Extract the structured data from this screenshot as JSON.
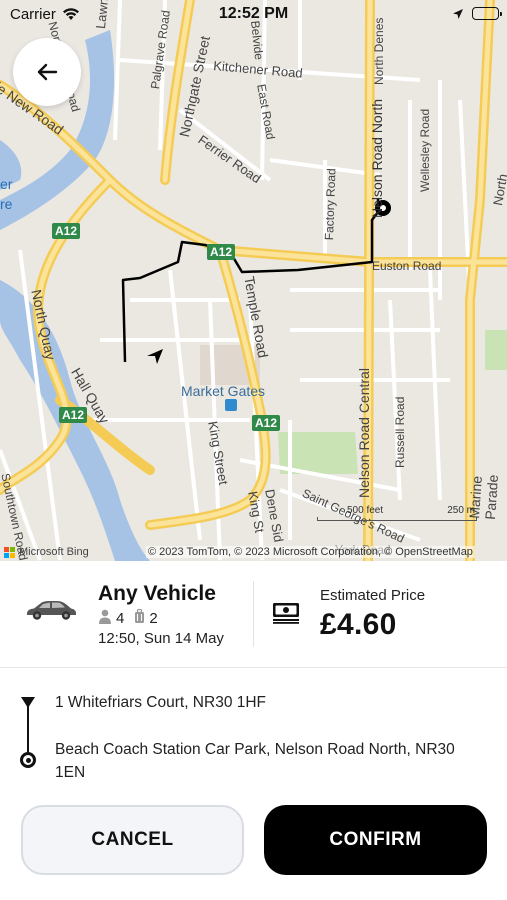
{
  "status_bar": {
    "carrier": "Carrier",
    "time": "12:52 PM"
  },
  "map": {
    "labels": {
      "lawn_avenue": "Lawn Ave",
      "north_river_road": "North River Road",
      "palgrave_road": "Palgrave Road",
      "northgate_street": "Northgate Street",
      "belvidere": "Belvide",
      "north_denes": "North Denes",
      "kitchener_road": "Kitchener Road",
      "east_road": "East Road",
      "ferrier_road": "Ferrier Road",
      "wellesley_road": "Wellesley Road",
      "north_drive": "North Drive",
      "nelson_road_north": "Nelson Road North",
      "factory_road": "Factory Road",
      "euston_road": "Euston Road",
      "new_road": "de New Road",
      "er": "er",
      "re": "re",
      "a12_1": "A12",
      "a12_2": "A12",
      "a12_3": "A12",
      "a12_4": "A12",
      "north_quay": "North Quay",
      "hall_quay": "Hall Quay",
      "temple_road": "Temple Road",
      "market_gates": "Market Gates",
      "king_street": "King Street",
      "king_st2": "King St",
      "dene_side": "Dene Sid",
      "nelson_road_central": "Nelson Road Central",
      "russell_road": "Russell Road",
      "marine_parade": "Marine Parade",
      "southtown": "Southtown Road",
      "saint_george": "Saint George's Road",
      "york_road": "York Road"
    },
    "scale_left": "500 feet",
    "scale_right": "250 m",
    "bing_label": "Microsoft Bing",
    "copyright": "© 2023 TomTom, © 2023 Microsoft Corporation, © OpenStreetMap"
  },
  "vehicle": {
    "name": "Any Vehicle",
    "passengers": "4",
    "luggage": "2",
    "time": "12:50, Sun 14 May",
    "icon": "car-icon"
  },
  "price": {
    "label": "Estimated Price",
    "value": "£4.60",
    "icon": "banknote-icon"
  },
  "route": {
    "pickup": "1 Whitefriars Court, NR30 1HF",
    "dropoff": "Beach Coach Station Car Park, Nelson Road North, NR30 1EN"
  },
  "buttons": {
    "cancel": "CANCEL",
    "confirm": "CONFIRM"
  },
  "colors": {
    "major_road": "#f7d26b",
    "water": "#a6c3e6",
    "park": "#c9e3b4",
    "route": "#000000",
    "confirm_bg": "#000000",
    "cancel_bg": "#f3f5f9"
  }
}
